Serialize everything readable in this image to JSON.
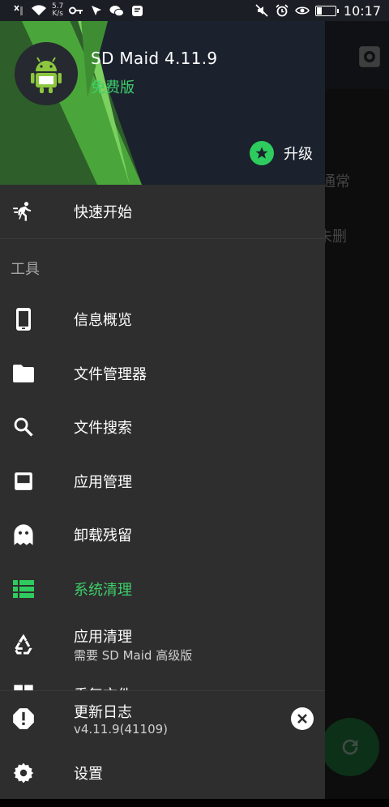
{
  "status_bar": {
    "net_speed_value": "5.7",
    "net_speed_unit": "K/s",
    "time": "10:17",
    "battery_percent": 30,
    "icons": [
      "sim-x-icon",
      "wifi-icon",
      "key-icon",
      "location-arrow-icon",
      "wechat-icon",
      "message-icon",
      "mute-icon",
      "alarm-icon",
      "eye-icon",
      "battery-icon"
    ]
  },
  "background_app": {
    "partial_text_1": "通常",
    "partial_text_2": "未删",
    "icons": [
      "gear-icon",
      "refresh-icon"
    ]
  },
  "drawer": {
    "header": {
      "app_name": "SD Maid 4.11.9",
      "edition": "免费版",
      "upgrade_label": "升级"
    },
    "quick_start": "快速开始",
    "tools_section": "工具",
    "items": [
      {
        "label": "信息概览",
        "icon": "phone-icon"
      },
      {
        "label": "文件管理器",
        "icon": "folder-icon"
      },
      {
        "label": "文件搜索",
        "icon": "search-icon"
      },
      {
        "label": "应用管理",
        "icon": "app-box-icon"
      },
      {
        "label": "卸载残留",
        "icon": "ghost-icon"
      },
      {
        "label": "系统清理",
        "icon": "list-icon"
      },
      {
        "label": "应用清理",
        "icon": "recycle-icon",
        "sublabel": "需要 SD Maid 高级版"
      },
      {
        "label": "重复文件",
        "icon": "duplicate-icon"
      }
    ],
    "footer": {
      "changelog_label": "更新日志",
      "changelog_version": "v4.11.9(41109)",
      "settings_label": "设置"
    },
    "accent_color": "#3ecf6a"
  }
}
